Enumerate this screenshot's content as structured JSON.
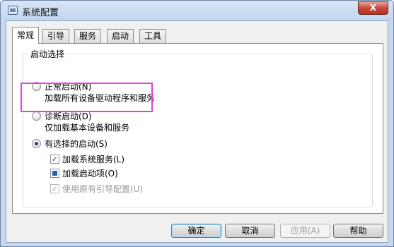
{
  "window": {
    "title": "系统配置",
    "close_label": "X"
  },
  "tabs": [
    {
      "label": "常规",
      "active": true
    },
    {
      "label": "引导",
      "active": false
    },
    {
      "label": "服务",
      "active": false
    },
    {
      "label": "启动",
      "active": false
    },
    {
      "label": "工具",
      "active": false
    }
  ],
  "startup_group": {
    "title": "启动选择",
    "normal": {
      "label": "正常启动(N)",
      "desc": "加载所有设备驱动程序和服务",
      "selected": false
    },
    "diagnostic": {
      "label": "诊断启动(D)",
      "desc": "仅加载基本设备和服务",
      "selected": false
    },
    "selective": {
      "label": "有选择的启动(S)",
      "selected": true,
      "options": [
        {
          "label": "加载系统服务(L)",
          "state": "checked",
          "enabled": true
        },
        {
          "label": "加载启动项(O)",
          "state": "indeterminate",
          "enabled": true
        },
        {
          "label": "使用原有引导配置(U)",
          "state": "checked",
          "enabled": false
        }
      ]
    }
  },
  "buttons": {
    "ok": "确定",
    "cancel": "取消",
    "apply": "应用(A)",
    "help": "帮助"
  },
  "colors": {
    "highlight": "#e63de6",
    "accent": "#1d3f7a"
  }
}
